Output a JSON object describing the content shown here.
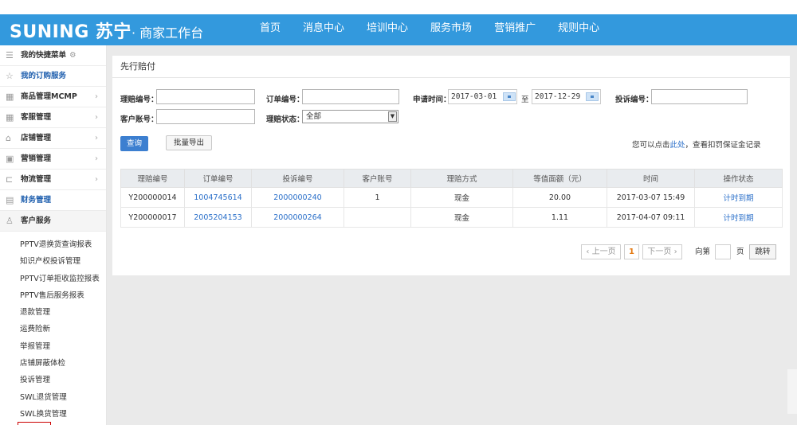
{
  "header": {
    "logo_main": "SUNING 苏宁",
    "logo_sub": "· 商家工作台",
    "nav": [
      "首页",
      "消息中心",
      "培训中心",
      "服务市场",
      "营销推广",
      "规则中心"
    ]
  },
  "sidebar": {
    "items": [
      {
        "label": "我的快捷菜单",
        "icon": "menu-icon"
      },
      {
        "label": "我的订购服务",
        "icon": "star-icon"
      },
      {
        "label": "商品管理MCMP",
        "icon": "grid-icon"
      },
      {
        "label": "客服管理",
        "icon": "grid-icon"
      },
      {
        "label": "店铺管理",
        "icon": "store-icon"
      },
      {
        "label": "营销管理",
        "icon": "gift-icon"
      },
      {
        "label": "物流管理",
        "icon": "truck-icon"
      },
      {
        "label": "财务管理",
        "icon": "finance-icon"
      },
      {
        "label": "客户服务",
        "icon": "user-icon"
      }
    ],
    "sub_items": [
      "PPTV退换货查询报表",
      "知识产权投诉管理",
      "PPTV订单拒收监控报表",
      "PPTV售后服务报表",
      "退款管理",
      "运费险新",
      "举报管理",
      "店铺屏蔽体检",
      "投诉管理",
      "SWL退货管理",
      "SWL换货管理"
    ]
  },
  "panel": {
    "title": "先行赔付",
    "form": {
      "claim_no_label": "理赔编号：",
      "order_no_label": "订单编号：",
      "apply_time_label": "申请时间：",
      "date_from": "2017-03-01",
      "date_sep": "至",
      "date_to": "2017-12-29",
      "complaint_no_label": "投诉编号：",
      "customer_label": "客户账号：",
      "status_label": "理赔状态：",
      "status_value": "全部"
    },
    "query_button": "查询",
    "export_button": "批量导出",
    "hint_prefix": "您可以点击",
    "hint_link": "此处",
    "hint_suffix": "，查看扣罚保证金记录",
    "table": {
      "headers": [
        "理赔编号",
        "订单编号",
        "投诉编号",
        "客户账号",
        "理赔方式",
        "等值面额（元）",
        "时间",
        "操作状态"
      ],
      "rows": [
        [
          "Y200000014",
          "1004745614",
          "2000000240",
          "1",
          "现金",
          "20.00",
          "2017-03-07 15:49",
          "计时到期"
        ],
        [
          "Y200000017",
          "2005204153",
          "2000000264",
          "",
          "现金",
          "1.11",
          "2017-04-07 09:11",
          "计时到期"
        ]
      ]
    },
    "pager": {
      "prev": "上一页",
      "current": "1",
      "next": "下一页",
      "goto_prefix": "向第",
      "goto_suffix": "页",
      "go_button": "跳转"
    }
  }
}
